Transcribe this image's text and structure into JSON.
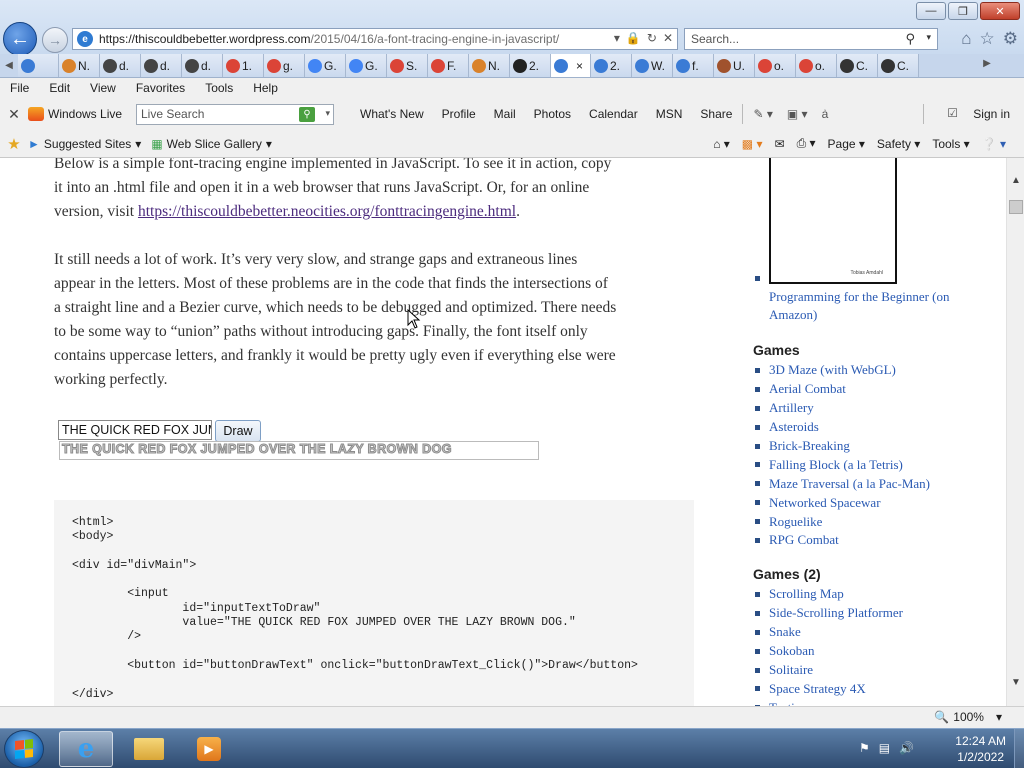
{
  "browser": {
    "address_host": "https://thiscouldbebetter.wordpress.com",
    "address_path": "/2015/04/16/a-font-tracing-engine-in-javascript/",
    "search_placeholder": "Search...",
    "tabs": [
      {
        "label": "",
        "icon": "ie-page-icon",
        "color": "#3a7bd5"
      },
      {
        "label": "N.",
        "icon": "cat-icon",
        "color": "#d9822b"
      },
      {
        "label": "d.",
        "icon": "crown-icon",
        "color": "#444444"
      },
      {
        "label": "d.",
        "icon": "crown-icon",
        "color": "#444444"
      },
      {
        "label": "d.",
        "icon": "crown-icon",
        "color": "#444444"
      },
      {
        "label": "1.",
        "icon": "chrome-icon",
        "color": "#db4437"
      },
      {
        "label": "g.",
        "icon": "chrome-icon",
        "color": "#db4437"
      },
      {
        "label": "G.",
        "icon": "google-icon",
        "color": "#4285f4"
      },
      {
        "label": "G.",
        "icon": "google-icon",
        "color": "#4285f4"
      },
      {
        "label": "S.",
        "icon": "chrome-icon",
        "color": "#db4437"
      },
      {
        "label": "F.",
        "icon": "chrome-icon",
        "color": "#db4437"
      },
      {
        "label": "N.",
        "icon": "cat-icon",
        "color": "#d9822b"
      },
      {
        "label": "2.",
        "icon": "chess-icon",
        "color": "#222222"
      },
      {
        "label": "",
        "icon": "ie-page-icon",
        "color": "#3a7bd5",
        "active": true
      },
      {
        "label": "2.",
        "icon": "ie-page-icon",
        "color": "#3a7bd5"
      },
      {
        "label": "W.",
        "icon": "ie-page-icon",
        "color": "#3a7bd5"
      },
      {
        "label": "f.",
        "icon": "ie-page-icon",
        "color": "#3a7bd5"
      },
      {
        "label": "U.",
        "icon": "person-icon",
        "color": "#a0522d"
      },
      {
        "label": "o.",
        "icon": "chrome-icon",
        "color": "#db4437"
      },
      {
        "label": "o.",
        "icon": "chrome-icon",
        "color": "#db4437"
      },
      {
        "label": "C.",
        "icon": "cube-icon",
        "color": "#333333"
      },
      {
        "label": "C.",
        "icon": "cube-icon",
        "color": "#333333"
      }
    ]
  },
  "menu": [
    "File",
    "Edit",
    "View",
    "Favorites",
    "Tools",
    "Help"
  ],
  "live_toolbar": {
    "brand": "Windows Live",
    "search_placeholder": "Live Search",
    "links": [
      "What's New",
      "Profile",
      "Mail",
      "Photos",
      "Calendar",
      "MSN",
      "Share"
    ],
    "sign_in": "Sign in"
  },
  "favorites_bar": {
    "suggested": "Suggested Sites",
    "slice": "Web Slice Gallery",
    "page": "Page",
    "safety": "Safety",
    "tools": "Tools"
  },
  "article": {
    "p1_line1": "Below is a simple font-tracing engine implemented in JavaScript. To see it in action, copy",
    "p1_line2": "it into an .html file and open it in a web browser that runs JavaScript. Or, for an online",
    "p1_line3_pre": "version, visit ",
    "p1_link": "https://thiscouldbebetter.neocities.org/fonttracingengine.html",
    "p1_line3_post": ".",
    "p2_line1": "It still needs a lot of work. It’s very very slow, and strange gaps and extraneous lines",
    "p2_line2": "appear in the letters. Most of these problems are in the code that finds the intersections of",
    "p2_line3": "a straight line and a Bezier curve, which needs to be debugged and optimized. There needs",
    "p2_line4": "to be some way to “union” paths without introducing gaps. Finally, the font itself only",
    "p2_line5": "contains uppercase letters, and frankly it would be pretty ugly even if everything else were",
    "p2_line6": "working perfectly.",
    "demo_input_value": "THE QUICK RED FOX JUMPED OVER THE LAZY BROWN DOG.",
    "demo_button": "Draw",
    "demo_render": "THE QUICK RED FOX JUMPED OVER THE LAZY BROWN DOG",
    "code": "<html>\n<body>\n\n<div id=\"divMain\">\n\n        <input\n                id=\"inputTextToDraw\"\n                value=\"THE QUICK RED FOX JUMPED OVER THE LAZY BROWN DOG.\"\n        />\n\n        <button id=\"buttonDrawText\" onclick=\"buttonDrawText_Click()\">Draw</button>\n\n</div>"
  },
  "sidebar": {
    "book_author": "Tobias Amdahl",
    "book_link": "Programming for the Beginner (on Amazon)",
    "games_heading": "Games",
    "games": [
      "3D Maze (with WebGL)",
      "Aerial Combat",
      "Artillery",
      "Asteroids",
      "Brick-Breaking",
      "Falling Block (a la Tetris)",
      "Maze Traversal (a la Pac-Man)",
      "Networked Spacewar",
      "Roguelike",
      "RPG Combat"
    ],
    "games2_heading": "Games (2)",
    "games2": [
      "Scrolling Map",
      "Side-Scrolling Platformer",
      "Snake",
      "Sokoban",
      "Solitaire",
      "Space Strategy 4X",
      "Tactics"
    ]
  },
  "status": {
    "zoom": "100%"
  },
  "taskbar": {
    "time": "12:24 AM",
    "date": "1/2/2022"
  }
}
